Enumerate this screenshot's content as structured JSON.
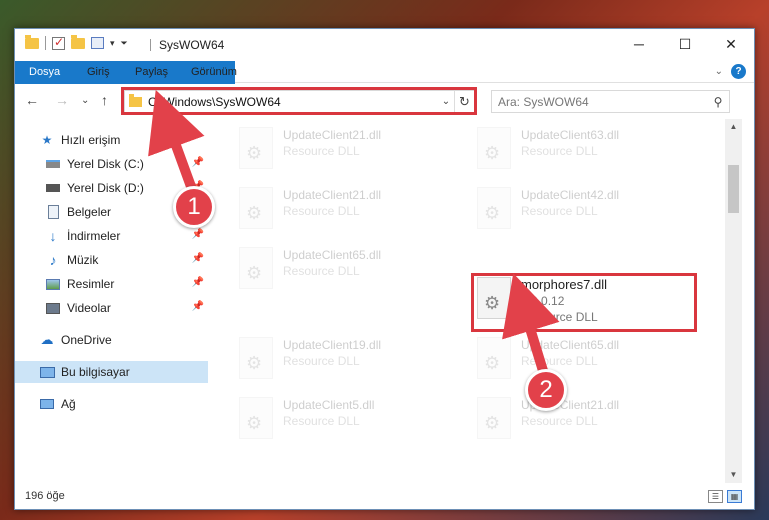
{
  "window": {
    "title": "SysWOW64"
  },
  "ribbon": {
    "tabs": [
      "Dosya",
      "Giriş",
      "Paylaş",
      "Görünüm"
    ]
  },
  "nav": {
    "address_path": "C:\\Windows\\SysWOW64",
    "search_placeholder": "Ara: SysWOW64"
  },
  "sidebar": {
    "items": [
      {
        "label": "Hızlı erişim",
        "icon": "star-icon"
      },
      {
        "label": "Yerel Disk (C:)",
        "icon": "drive-icon",
        "pinned": true
      },
      {
        "label": "Yerel Disk (D:)",
        "icon": "drive-icon",
        "pinned": true
      },
      {
        "label": "Belgeler",
        "icon": "document-icon",
        "pinned": true
      },
      {
        "label": "İndirmeler",
        "icon": "download-icon",
        "pinned": true
      },
      {
        "label": "Müzik",
        "icon": "music-icon",
        "pinned": true
      },
      {
        "label": "Resimler",
        "icon": "pictures-icon",
        "pinned": true
      },
      {
        "label": "Videolar",
        "icon": "video-icon",
        "pinned": true
      },
      {
        "label": "OneDrive",
        "icon": "cloud-icon"
      },
      {
        "label": "Bu bilgisayar",
        "icon": "computer-icon",
        "selected": true
      },
      {
        "label": "Ağ",
        "icon": "network-icon"
      }
    ]
  },
  "files": [
    {
      "name": "UpdateClient21.dll",
      "type": "Resource DLL"
    },
    {
      "name": "UpdateClient63.dll",
      "type": "Resource DLL"
    },
    {
      "name": "UpdateClient21.dll",
      "type": "Resource DLL"
    },
    {
      "name": "UpdateClient42.dll",
      "type": "Resource DLL"
    },
    {
      "name": "UpdateClient65.dll",
      "type": "Resource DLL"
    },
    {
      "name": "morphores7.dll",
      "version": "4.0.0.12",
      "type": "Resource DLL"
    },
    {
      "name": "UpdateClient19.dll",
      "type": "Resource DLL"
    },
    {
      "name": "UpdateClient65.dll",
      "type": "Resource DLL"
    },
    {
      "name": "UpdateClient5.dll",
      "type": "Resource DLL"
    },
    {
      "name": "UpdateClient21.dll",
      "type": "Resource DLL"
    }
  ],
  "status": {
    "item_count": "196 öğe"
  },
  "annotations": {
    "step1": "1",
    "step2": "2",
    "color": "#e2414a"
  }
}
